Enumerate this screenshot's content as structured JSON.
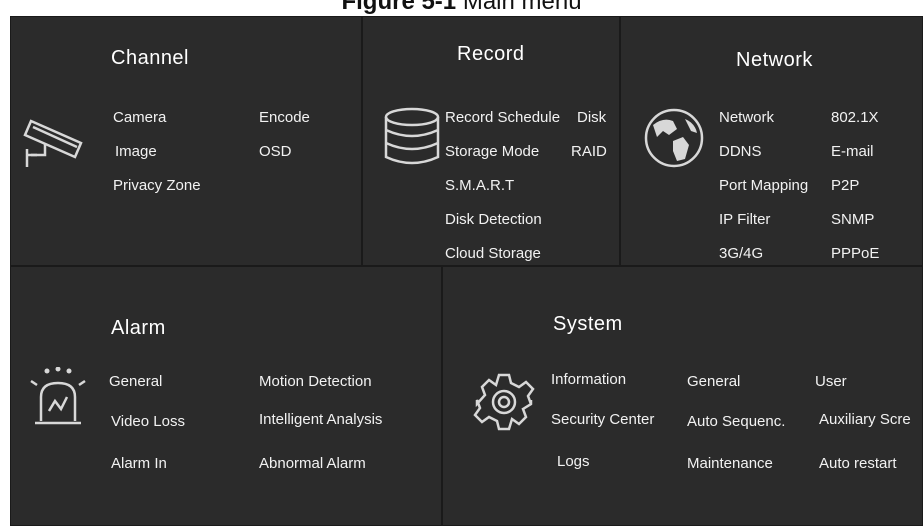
{
  "caption": {
    "bold": "Figure 5-1",
    "rest": " Main menu"
  },
  "channel": {
    "title": "Channel",
    "icon": "camera-icon",
    "items": [
      "Camera",
      "Encode",
      "Image",
      "OSD",
      "Privacy Zone"
    ]
  },
  "record": {
    "title": "Record",
    "icon": "database-icon",
    "items": [
      "Record Schedule",
      "Disk",
      "Storage Mode",
      "RAID",
      "S.M.A.R.T",
      "Disk Detection",
      "Cloud Storage"
    ]
  },
  "network": {
    "title": "Network",
    "icon": "globe-icon",
    "items": [
      "Network",
      "802.1X",
      "DDNS",
      "E-mail",
      "Port Mapping",
      "P2P",
      "IP Filter",
      "SNMP",
      "3G/4G",
      "PPPoE"
    ]
  },
  "alarm": {
    "title": "Alarm",
    "icon": "alarm-light-icon",
    "items": [
      "General",
      "Motion Detection",
      "Video Loss",
      "Intelligent Analysis",
      "Alarm In",
      "Abnormal Alarm"
    ]
  },
  "system": {
    "title": "System",
    "icon": "gear-icon",
    "items": [
      "Information",
      "General",
      "User",
      "Security Center",
      "Auto Sequenc.",
      "Auxiliary Scre",
      "Logs",
      "Maintenance",
      "Auto restart"
    ]
  },
  "colors": {
    "background": "#222222",
    "panel": "#2b2b2b",
    "text": "#f2f2f2",
    "icon": "#d8d8d8"
  }
}
